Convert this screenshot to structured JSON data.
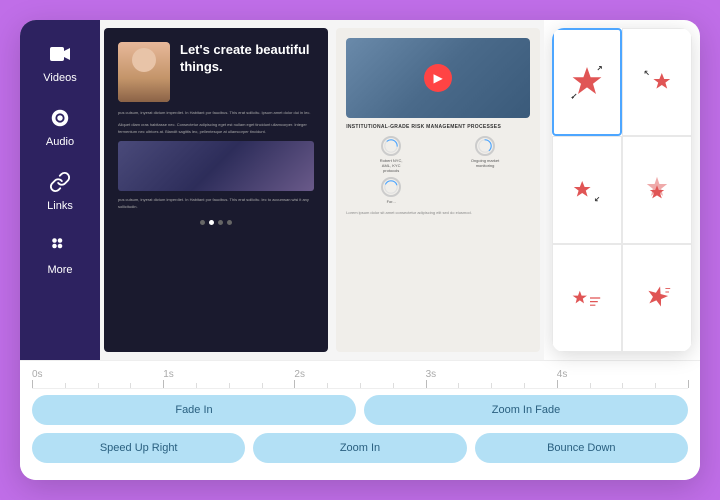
{
  "sidebar": {
    "items": [
      {
        "id": "videos",
        "label": "Videos",
        "icon": "🎬"
      },
      {
        "id": "audio",
        "label": "Audio",
        "icon": "🎵"
      },
      {
        "id": "links",
        "label": "Links",
        "icon": "🔗"
      },
      {
        "id": "more",
        "label": "More",
        "icon": "⋮⋮"
      }
    ]
  },
  "document": {
    "left": {
      "headline": "Let's create beautiful things.",
      "body_text_1": "pus culsum, inyerat dictum imperdiet. In Habitant por faucibus. This erat sollicitu. Ipsum amet dolor dui in lec.",
      "body_text_2": "Aliquet diam cras habitasse nec. Consectetur adipiscing eget est nullam eget tincidunt ullamcorper. Integer fermentum nec ultrices at. Blandit sagittis leo, pellentesque at ullamcorper tincidunt.",
      "body_text_3": "pus culsum, inyerat dictum imperdiet. In Habitant por faucibus. This erat sollicitu. lec to accumsan wisi it any sollicitudin.",
      "dots": [
        false,
        true,
        false,
        false
      ]
    },
    "right": {
      "section_title": "INSTITUTIONAL-GRADE RISK MANAGEMENT PROCESSES",
      "risk_items": [
        {
          "label": "Robert NYC, AML, KYC protocols",
          "pct": 40
        },
        {
          "label": "Ongoing market monitoring",
          "pct": 60
        },
        {
          "label": "For",
          "pct": 30
        }
      ],
      "body_text": "Lorem ipsum dolor sit amet consectetur adipiscing elit sed do eiusmod."
    }
  },
  "star_panel": {
    "cells": [
      {
        "id": "star-expand",
        "selected": true,
        "type": "expand",
        "color": "#e05555"
      },
      {
        "id": "star-shrink-right",
        "selected": false,
        "type": "shrink-right",
        "color": "#e05555"
      },
      {
        "id": "star-shrink-left",
        "selected": false,
        "type": "shrink-left",
        "color": "#e05555"
      },
      {
        "id": "star-bounce",
        "selected": false,
        "type": "bounce",
        "color": "#e05555"
      },
      {
        "id": "star-small-left",
        "selected": false,
        "type": "small-left",
        "color": "#e05555"
      },
      {
        "id": "star-wiggle",
        "selected": false,
        "type": "wiggle",
        "color": "#e05555"
      }
    ]
  },
  "timeline": {
    "labels": [
      "0s",
      "1s",
      "2s",
      "3s",
      "4s"
    ],
    "label_positions": [
      0,
      20,
      40,
      60,
      80
    ]
  },
  "animation_buttons": {
    "row1": [
      {
        "id": "fade-in",
        "label": "Fade In"
      },
      {
        "id": "zoom-in-fade",
        "label": "Zoom In Fade"
      }
    ],
    "row2": [
      {
        "id": "speed-up-right",
        "label": "Speed Up Right"
      },
      {
        "id": "zoom-in",
        "label": "Zoom In"
      },
      {
        "id": "bounce-down",
        "label": "Bounce Down"
      }
    ]
  }
}
